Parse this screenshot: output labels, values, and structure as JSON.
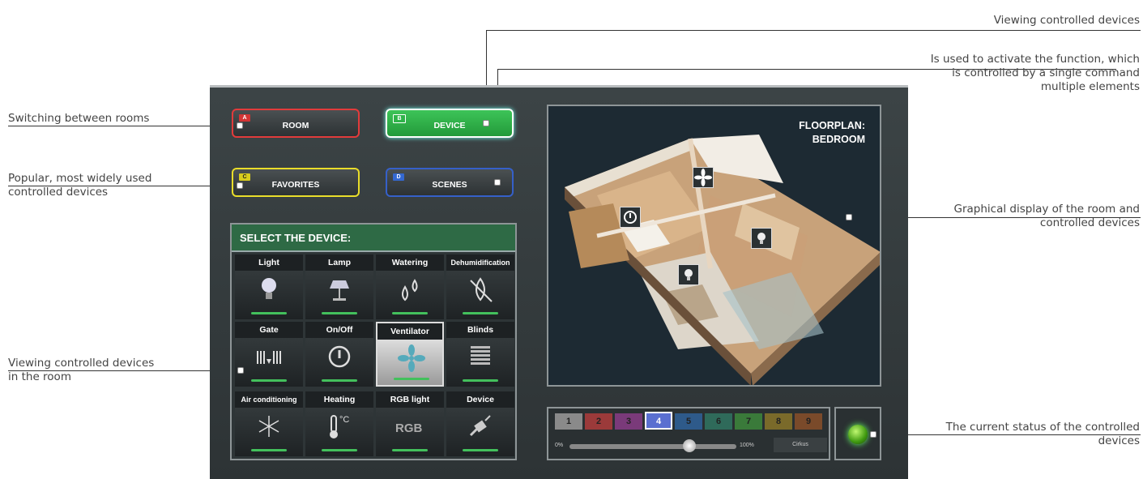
{
  "annotations": {
    "rooms": "Switching between rooms",
    "popular_1": "Popular, most widely used",
    "popular_2": "controlled devices",
    "room_devices_1": "Viewing controlled devices",
    "room_devices_2": "in the room",
    "viewing": "Viewing controlled devices",
    "activate_1": "Is used to activate the function, which",
    "activate_2": "is controlled by a single command",
    "activate_3": "multiple elements",
    "graphical_1": "Graphical display of the room and",
    "graphical_2": "controlled devices",
    "status_1": "The current status of the controlled",
    "status_2": "devices"
  },
  "nav": [
    {
      "tag": "A",
      "label": "ROOM",
      "color": "#e23b3b",
      "bg": "#d43535",
      "active": false
    },
    {
      "tag": "B",
      "label": "DEVICE",
      "color": "#ffffff",
      "bg": "#2fb44a",
      "active": true
    },
    {
      "tag": "C",
      "label": "FAVORITES",
      "color": "#e9dd2a",
      "bg": "#d8cc1c",
      "active": false
    },
    {
      "tag": "D",
      "label": "SCENES",
      "color": "#3560c9",
      "bg": "#3468d0",
      "active": false
    }
  ],
  "device_panel": {
    "title": "SELECT THE DEVICE:",
    "devices": [
      {
        "label": "Light",
        "icon": "bulb-icon"
      },
      {
        "label": "Lamp",
        "icon": "lamp-icon"
      },
      {
        "label": "Watering",
        "icon": "water-drops-icon"
      },
      {
        "label": "Dehumidification",
        "icon": "no-drop-icon"
      },
      {
        "label": "Gate",
        "icon": "gate-icon"
      },
      {
        "label": "On/Off",
        "icon": "power-icon"
      },
      {
        "label": "Ventilator",
        "icon": "fan-icon",
        "selected": true
      },
      {
        "label": "Blinds",
        "icon": "blinds-icon"
      },
      {
        "label": "Air conditioning",
        "icon": "snowflake-icon"
      },
      {
        "label": "Heating",
        "icon": "thermometer-icon",
        "suffix": "°C"
      },
      {
        "label": "RGB light",
        "icon": "rgb-icon",
        "text": "RGB"
      },
      {
        "label": "Device",
        "icon": "plug-icon"
      }
    ]
  },
  "floorplan": {
    "title_1": "FLOORPLAN:",
    "title_2": "BEDROOM"
  },
  "status_bar": {
    "numbers": [
      {
        "n": "1",
        "color": "#8a8a8a"
      },
      {
        "n": "2",
        "color": "#9b3a3a"
      },
      {
        "n": "3",
        "color": "#7a3a7a"
      },
      {
        "n": "4",
        "color": "#5a6fd0",
        "active": true
      },
      {
        "n": "5",
        "color": "#2e5a8a"
      },
      {
        "n": "6",
        "color": "#2f6a5a"
      },
      {
        "n": "7",
        "color": "#3a7a3a"
      },
      {
        "n": "8",
        "color": "#7a6a2a"
      },
      {
        "n": "9",
        "color": "#7a4a2a"
      }
    ],
    "slider_min": "0%",
    "slider_max": "100%",
    "slider_value": 0.72,
    "preset": "Cirkus"
  }
}
